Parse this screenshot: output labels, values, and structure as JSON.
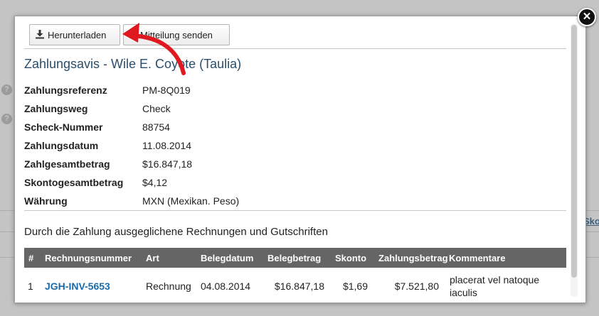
{
  "toolbar": {
    "download_label": "Herunterladen",
    "send_label": "Mitteilung senden"
  },
  "title": "Zahlungsavis - Wile E. Coyote (Taulia)",
  "details": [
    {
      "label": "Zahlungsreferenz",
      "value": "PM-8Q019"
    },
    {
      "label": "Zahlungsweg",
      "value": "Check"
    },
    {
      "label": "Scheck-Nummer",
      "value": "88754"
    },
    {
      "label": "Zahlungsdatum",
      "value": "11.08.2014"
    },
    {
      "label": "Zahlgesamtbetrag",
      "value": "$16.847,18"
    },
    {
      "label": "Skontogesamtbetrag",
      "value": "$4,12"
    },
    {
      "label": "Währung",
      "value": "MXN (Mexikan. Peso)"
    }
  ],
  "section_title": "Durch die Zahlung ausgeglichene Rechnungen und Gutschriften",
  "table": {
    "headers": [
      "#",
      "Rechnungsnummer",
      "Art",
      "Belegdatum",
      "Belegbetrag",
      "Skonto",
      "Zahlungsbetrag",
      "Kommentare"
    ],
    "rows": [
      [
        "1",
        "JGH-INV-5653",
        "Rechnung",
        "04.08.2014",
        "$16.847,18",
        "$1,69",
        "$7.521,80",
        "placerat vel natoque iaculis"
      ]
    ]
  },
  "background": {
    "link_text": "Sko",
    "help_glyph": "?"
  },
  "close_glyph": "✕",
  "colors": {
    "title": "#2b4d6b",
    "link": "#1a6aa8",
    "table_header": "#656565",
    "arrow": "#e0181f"
  }
}
